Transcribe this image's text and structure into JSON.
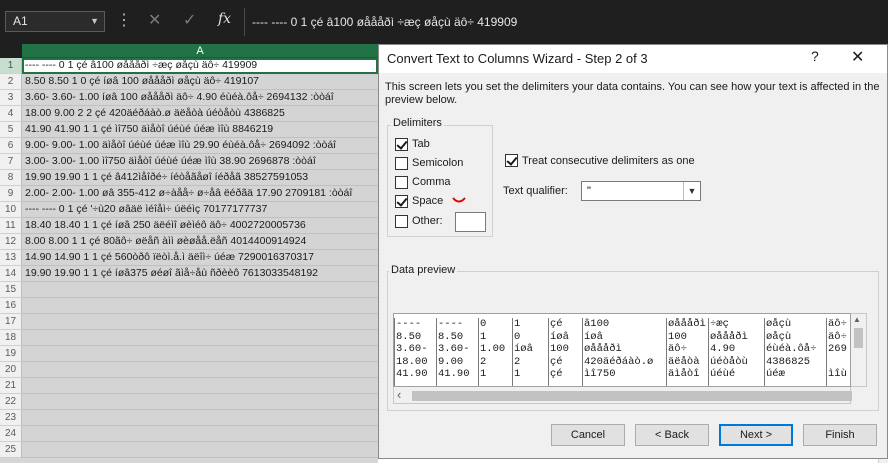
{
  "formula_bar": {
    "name_box": "A1",
    "formula_text": "---- ---- 0 1 çé â100 øåååðì ÷æç øåçù äô÷ 419909"
  },
  "sheet": {
    "column_header": "A",
    "rows": [
      {
        "n": "1",
        "text": "---- ---- 0 1 çé â100 øåååðì ÷æç øåçù äô÷ 419909"
      },
      {
        "n": "2",
        "text": "8.50 8.50 1 0 çé íøâ 100 øåååðì øåçù äô÷ 419107"
      },
      {
        "n": "3",
        "text": "3.60- 3.60- 1.00 íøâ 100 øåååðì äô÷ 4.90 éùéà.ôå÷ 2694132 :òòáî"
      },
      {
        "n": "4",
        "text": "18.00 9.00 2 2 çé 420äéðáàò.ø äëåòà úéòåòù 4386825"
      },
      {
        "n": "5",
        "text": "41.90 41.90 1 1 çé ìî750 äìåòî úéùé úéæ ìîù 8846219"
      },
      {
        "n": "6",
        "text": "9.00- 9.00- 1.00 äìåòî úéùé úéæ ìîù 29.90 éùéà.ôå÷ 2694092 :òòáî"
      },
      {
        "n": "7",
        "text": "3.00- 3.00- 1.00 ìî750 äìåòî úéùé úéæ ìîù 38.90 2696878 :òòáî"
      },
      {
        "n": "8",
        "text": "19.90 19.90 1 1 çé â412ìåîðé÷ íéòåãåøî íéðåã 38527591053"
      },
      {
        "n": "9",
        "text": "2.00- 2.00- 1.00 øâ 355-412 ø÷àåå÷ ø÷åâ ëéðãä 17.90 2709181 :òòáî"
      },
      {
        "n": "10",
        "text": "---- ---- 0 1 çé '÷ù20 øâäë ìéîåì÷ úëéìç 70177177737"
      },
      {
        "n": "11",
        "text": "18.40 18.40 1 1 çé íøâ 250 äëéìî øèìéô äô÷ 4002720005736"
      },
      {
        "n": "12",
        "text": "8.00 8.00 1 1 çé 80ãô÷ øëåñ àìì øèøåå.ëåñ 4014400914924"
      },
      {
        "n": "13",
        "text": "14.90 14.90 1 1 çé 560òðô ïëòì.å.ì äëîì÷ úéæ 7290016370317"
      },
      {
        "n": "14",
        "text": "19.90 19.90 1 1 çé íøâ375 øéøî ãìå÷åù ñðèèô 7613033548192"
      },
      {
        "n": "15",
        "text": ""
      },
      {
        "n": "16",
        "text": ""
      },
      {
        "n": "17",
        "text": ""
      },
      {
        "n": "18",
        "text": ""
      },
      {
        "n": "19",
        "text": ""
      },
      {
        "n": "20",
        "text": ""
      },
      {
        "n": "21",
        "text": ""
      },
      {
        "n": "22",
        "text": ""
      },
      {
        "n": "23",
        "text": ""
      },
      {
        "n": "24",
        "text": ""
      },
      {
        "n": "25",
        "text": ""
      }
    ]
  },
  "dialog": {
    "title": "Convert Text to Columns Wizard - Step 2 of 3",
    "help": "?",
    "close": "✕",
    "description": "This screen lets you set the delimiters your data contains.  You can see how your text is affected in the preview below.",
    "delimiters_label": "Delimiters",
    "delimiters": [
      {
        "label": "Tab",
        "checked": true
      },
      {
        "label": "Semicolon",
        "checked": false
      },
      {
        "label": "Comma",
        "checked": false
      },
      {
        "label": "Space",
        "checked": true
      },
      {
        "label": "Other:",
        "checked": false
      }
    ],
    "treat_consecutive": {
      "label": "Treat consecutive delimiters as one",
      "checked": true
    },
    "text_qualifier_label": "Text qualifier:",
    "text_qualifier_value": "\"",
    "data_preview_label": "Data preview",
    "preview_columns": [
      "----\n8.50\n3.60-\n18.00\n41.90",
      "----\n8.50\n3.60-\n9.00\n41.90",
      "0\n1\n1.00\n2\n1",
      "1\n0\níøâ\n2\n1",
      "çé\níøâ\n100\nçé\nçé",
      "â100\níøâ\nøåååðì\n420äéðáàò.ø\nìî750",
      "øåååðì\n100\näô÷\näëåòà\näìåòî",
      "÷æç\nøåååðì\n4.90\núéòåòù\núéùé",
      "øåçù\nøåçù\néùéà.ôå÷\n4386825\núéæ",
      "äô÷\näô÷\n269\n\nìîù"
    ],
    "buttons": {
      "cancel": "Cancel",
      "back": "< Back",
      "next": "Next >",
      "finish": "Finish"
    }
  }
}
